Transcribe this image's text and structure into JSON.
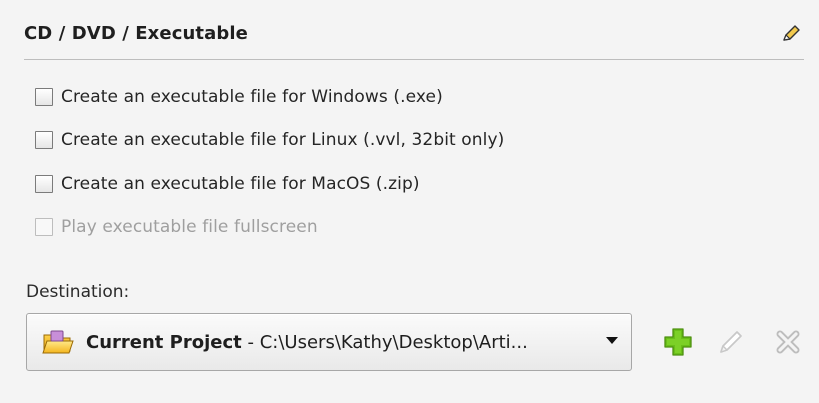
{
  "section": {
    "title": "CD / DVD / Executable",
    "title_edit_icon": "pencil-icon"
  },
  "options": [
    {
      "label": "Create an executable file for Windows (.exe)",
      "checked": false,
      "enabled": true
    },
    {
      "label": "Create an executable file for Linux (.vvl, 32bit only)",
      "checked": false,
      "enabled": true
    },
    {
      "label": "Create an executable file for MacOS (.zip)",
      "checked": false,
      "enabled": true
    },
    {
      "label": "Play executable file fullscreen",
      "checked": false,
      "enabled": false
    }
  ],
  "destination": {
    "label": "Destination:",
    "selected_name": "Current Project",
    "separator": " - ",
    "selected_path": "C:\\Users\\Kathy\\Desktop\\Arti...",
    "folder_icon": "folder-open-icon",
    "dropdown_icon": "chevron-down-icon"
  },
  "actions": {
    "add_icon": "plus-icon",
    "edit_icon": "pencil-icon",
    "delete_icon": "close-icon"
  },
  "colors": {
    "add_green": "#69bf18",
    "disabled_gray": "#c8c8c8",
    "pencil_yellow": "#f2c94c"
  }
}
